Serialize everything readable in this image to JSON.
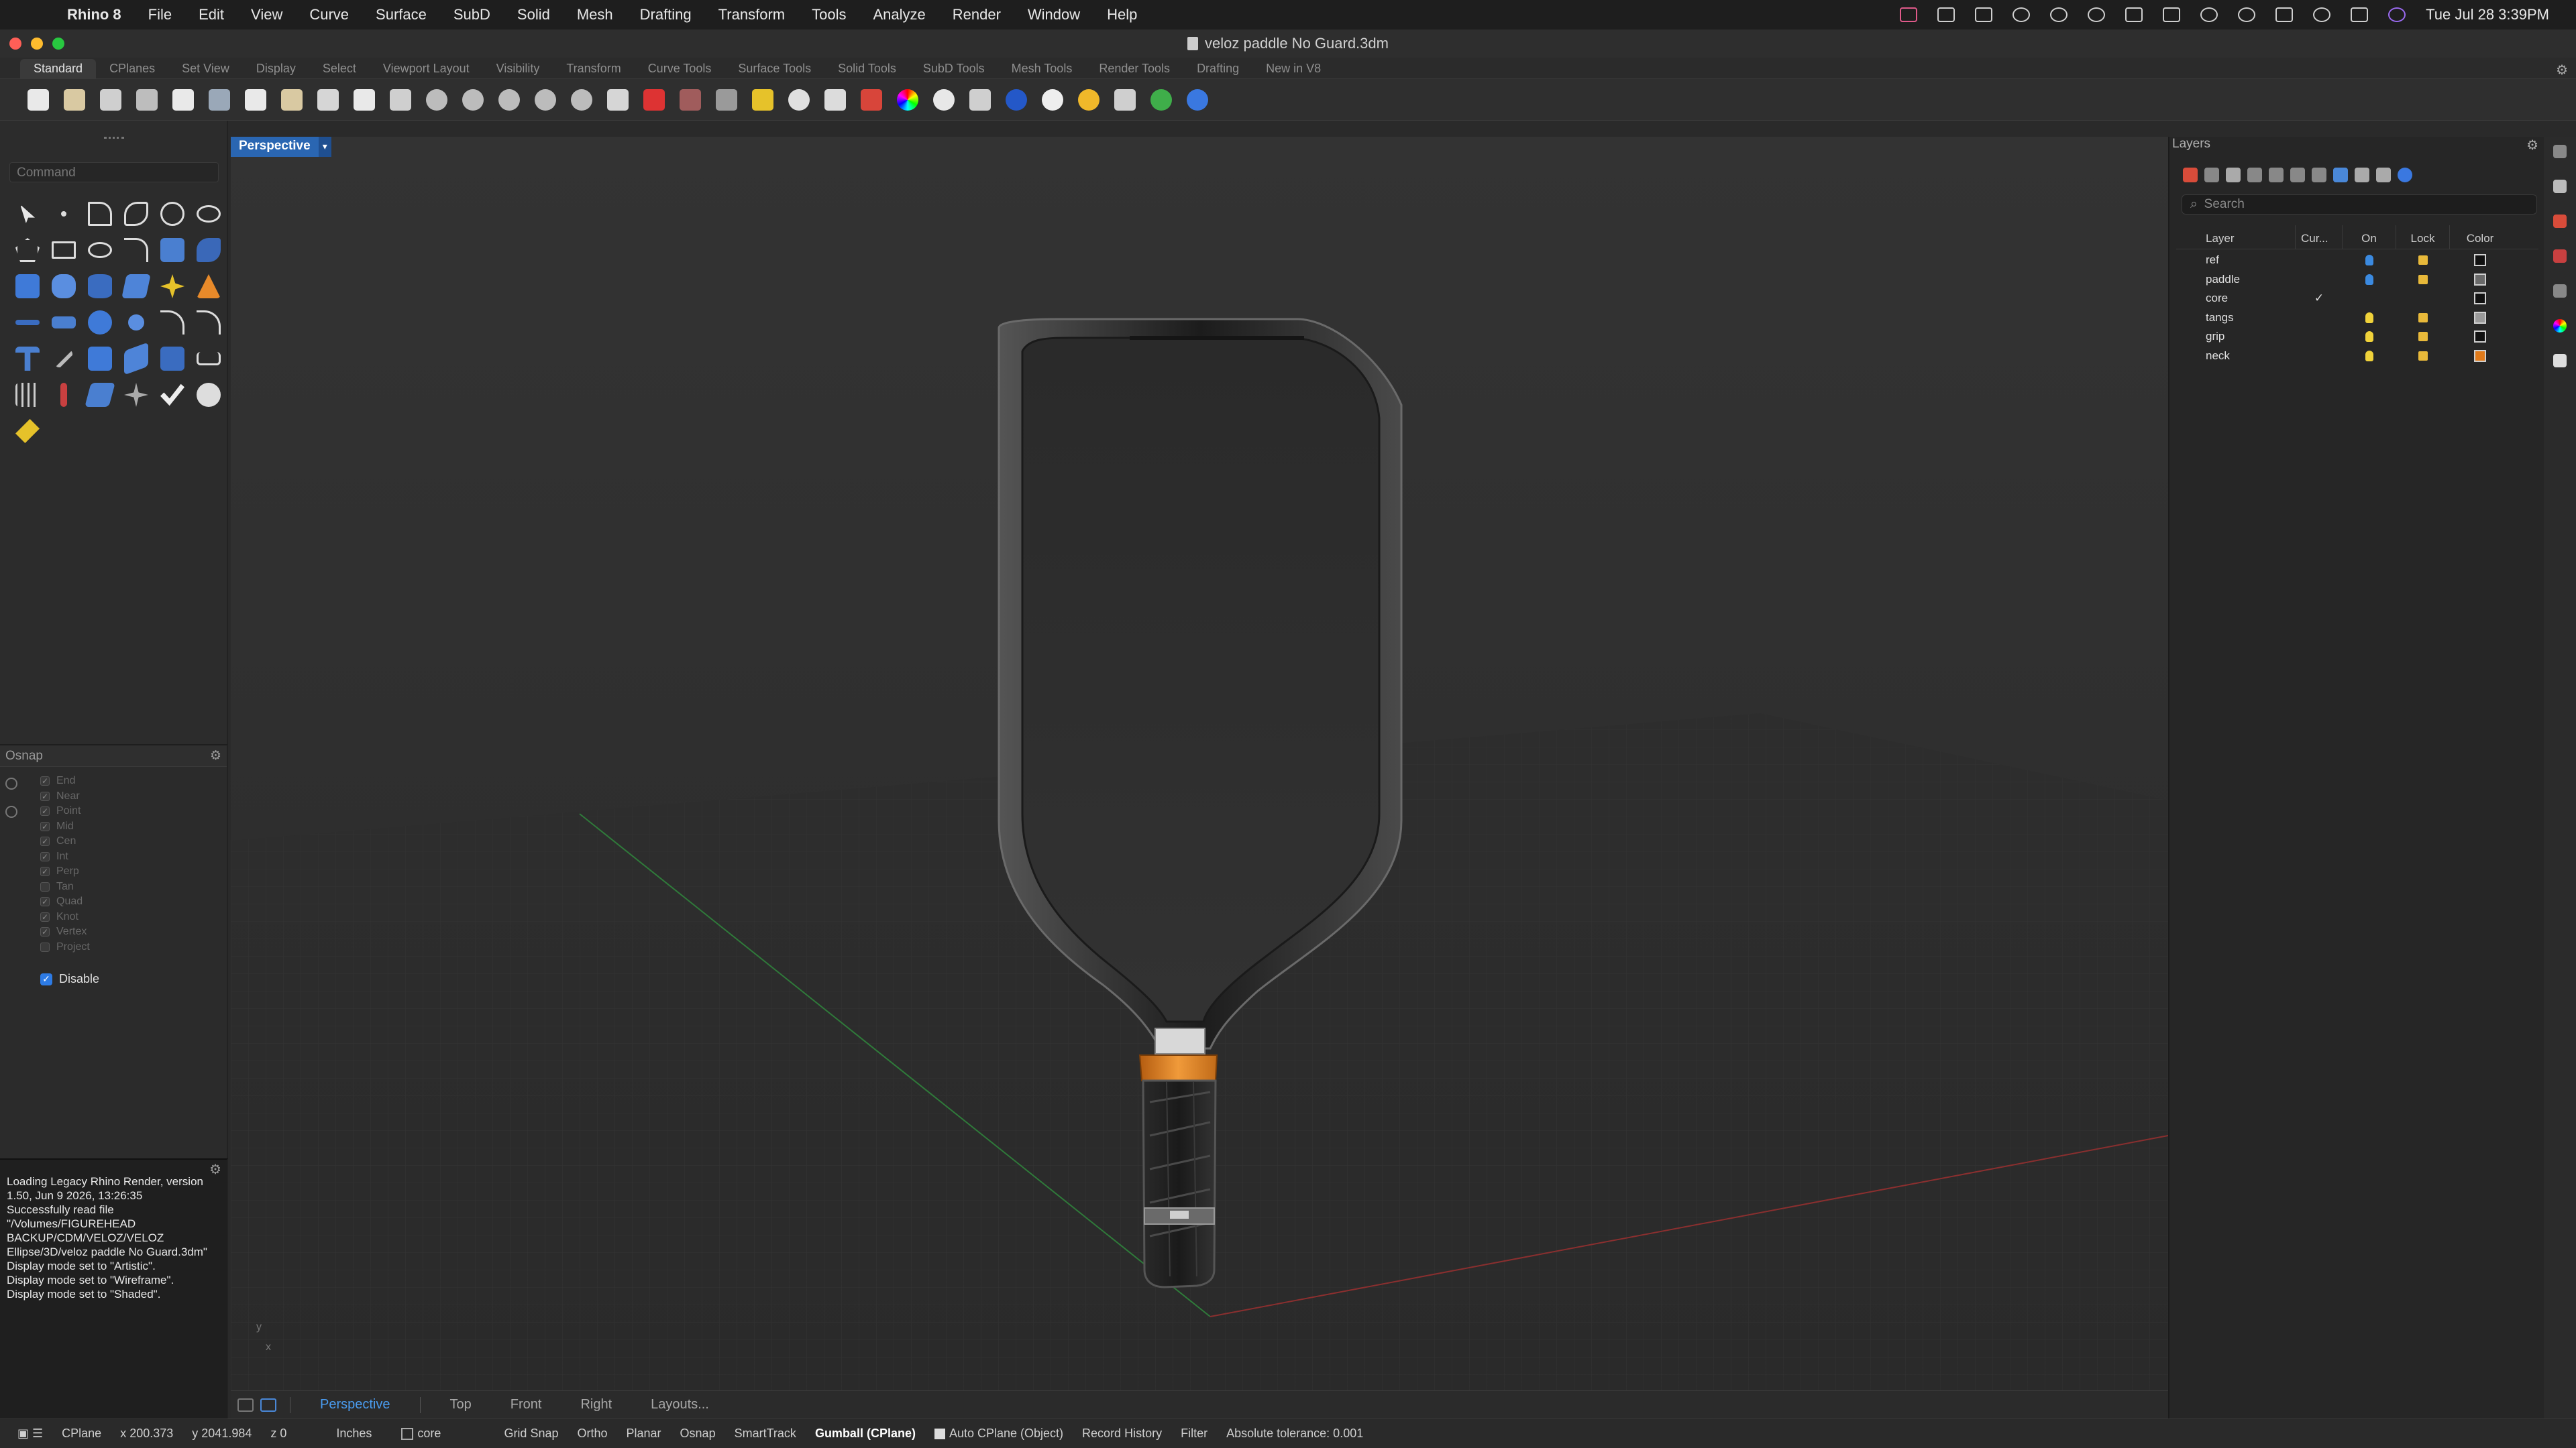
{
  "menubar": {
    "app": "Rhino 8",
    "items": [
      "File",
      "Edit",
      "View",
      "Curve",
      "Surface",
      "SubD",
      "Solid",
      "Mesh",
      "Drafting",
      "Transform",
      "Tools",
      "Analyze",
      "Render",
      "Window",
      "Help"
    ],
    "clock": "Tue Jul 28  3:39PM"
  },
  "window": {
    "title": "veloz paddle No Guard.3dm"
  },
  "tabs": [
    "Standard",
    "CPlanes",
    "Set View",
    "Display",
    "Select",
    "Viewport Layout",
    "Visibility",
    "Transform",
    "Curve Tools",
    "Surface Tools",
    "Solid Tools",
    "SubD Tools",
    "Mesh Tools",
    "Render Tools",
    "Drafting",
    "New in V8"
  ],
  "command": {
    "placeholder": "Command"
  },
  "osnap": {
    "title": "Osnap",
    "items": [
      {
        "label": "End",
        "checked": true
      },
      {
        "label": "Near",
        "checked": true
      },
      {
        "label": "Point",
        "checked": true
      },
      {
        "label": "Mid",
        "checked": true
      },
      {
        "label": "Cen",
        "checked": true
      },
      {
        "label": "Int",
        "checked": true
      },
      {
        "label": "Perp",
        "checked": true
      },
      {
        "label": "Tan",
        "checked": false
      },
      {
        "label": "Quad",
        "checked": true
      },
      {
        "label": "Knot",
        "checked": true
      },
      {
        "label": "Vertex",
        "checked": true
      },
      {
        "label": "Project",
        "checked": false
      }
    ],
    "disable_label": "Disable"
  },
  "history": {
    "lines": [
      "Loading Legacy Rhino Render, version 1.50, Jun  9 2026, 13:26:35",
      "Successfully read file \"/Volumes/FIGUREHEAD BACKUP/CDM/VELOZ/VELOZ Ellipse/3D/veloz paddle No Guard.3dm\"",
      "Display mode set to \"Artistic\".",
      "Display mode set to \"Wireframe\".",
      "Display mode set to \"Shaded\"."
    ]
  },
  "viewport": {
    "label": "Perspective",
    "axis_y": "y",
    "axis_x": "x"
  },
  "viewport_tabs": [
    "Perspective",
    "Top",
    "Front",
    "Right",
    "Layouts..."
  ],
  "layers": {
    "title": "Layers",
    "search_placeholder": "Search",
    "headers": [
      "Layer",
      "Cur...",
      "On",
      "Lock",
      "Color"
    ],
    "rows": [
      {
        "name": "ref",
        "current": "",
        "bulb": "#3b8ae0",
        "color": "#111111"
      },
      {
        "name": "paddle",
        "current": "",
        "bulb": "#3b8ae0",
        "color": "#6a6a6a"
      },
      {
        "name": "core",
        "current": "✓",
        "bulb": "",
        "color": "#111111"
      },
      {
        "name": "tangs",
        "current": "",
        "bulb": "#f0d23a",
        "color": "#9a9a9a"
      },
      {
        "name": "grip",
        "current": "",
        "bulb": "#f0d23a",
        "color": "#111111"
      },
      {
        "name": "neck",
        "current": "",
        "bulb": "#f0d23a",
        "color": "#e07a1a"
      }
    ]
  },
  "statusbar": {
    "cplane": "CPlane",
    "x": "x 200.373",
    "y": "y 2041.984",
    "z": "z 0",
    "units": "Inches",
    "layer": "core",
    "toggles": [
      "Grid Snap",
      "Ortho",
      "Planar",
      "Osnap",
      "SmartTrack"
    ],
    "gumball": "Gumball (CPlane)",
    "autocplane": "Auto CPlane (Object)",
    "record": "Record History",
    "filter": "Filter",
    "tolerance": "Absolute tolerance: 0.001"
  },
  "colors": {
    "accent": "#2a66b2",
    "neck_orange": "#e07a1a",
    "x_axis": "#8a2f2f",
    "y_axis": "#2f7a3a"
  }
}
